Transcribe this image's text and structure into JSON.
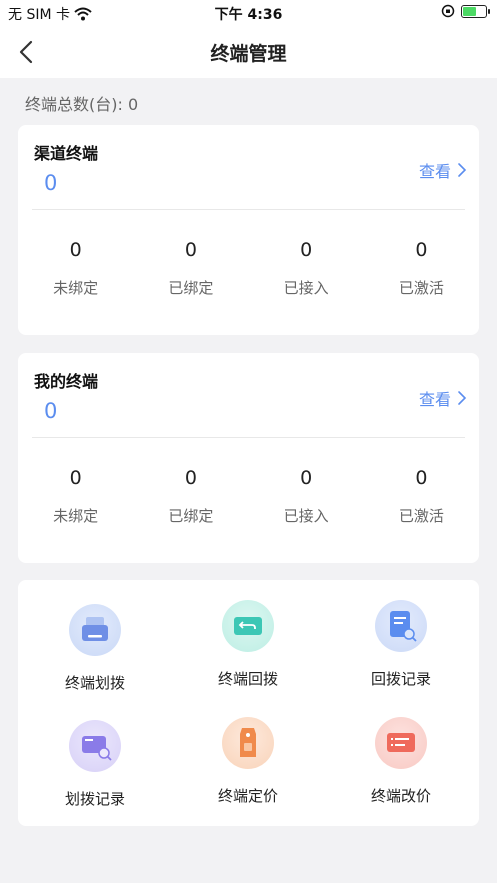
{
  "status_bar": {
    "carrier": "无 SIM 卡",
    "time": "下午 4:36"
  },
  "nav": {
    "title": "终端管理"
  },
  "total": {
    "label": "终端总数(台): 0"
  },
  "channel_card": {
    "title": "渠道终端",
    "total": "0",
    "view_label": "查看",
    "stats": [
      {
        "value": "0",
        "label": "未绑定"
      },
      {
        "value": "0",
        "label": "已绑定"
      },
      {
        "value": "0",
        "label": "已接入"
      },
      {
        "value": "0",
        "label": "已激活"
      }
    ]
  },
  "my_card": {
    "title": "我的终端",
    "total": "0",
    "view_label": "查看",
    "stats": [
      {
        "value": "0",
        "label": "未绑定"
      },
      {
        "value": "0",
        "label": "已绑定"
      },
      {
        "value": "0",
        "label": "已接入"
      },
      {
        "value": "0",
        "label": "已激活"
      }
    ]
  },
  "actions": [
    {
      "label": "终端划拨",
      "icon": "terminal-transfer-icon",
      "color": "#6f8fe6"
    },
    {
      "label": "终端回拨",
      "icon": "terminal-return-icon",
      "color": "#3cc7b5"
    },
    {
      "label": "回拨记录",
      "icon": "return-record-icon",
      "color": "#5b8def"
    },
    {
      "label": "划拨记录",
      "icon": "transfer-record-icon",
      "color": "#8a7be8"
    },
    {
      "label": "终端定价",
      "icon": "terminal-pricing-icon",
      "color": "#f08a4b"
    },
    {
      "label": "终端改价",
      "icon": "terminal-reprice-icon",
      "color": "#ef6a5c"
    }
  ]
}
